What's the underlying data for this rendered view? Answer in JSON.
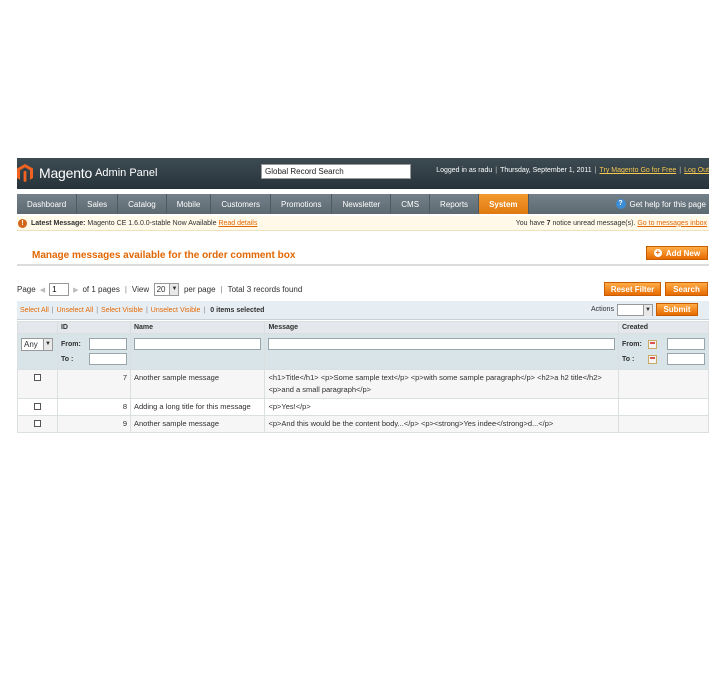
{
  "header": {
    "logo_text": "Magento",
    "logo_sub": "Admin Panel",
    "global_search_value": "Global Record Search",
    "logged_in": "Logged in as radu",
    "date": "Thursday, September 1, 2011",
    "try_link": "Try Magento Go for Free",
    "logout_link": "Log Out"
  },
  "nav": {
    "items": [
      "Dashboard",
      "Sales",
      "Catalog",
      "Mobile",
      "Customers",
      "Promotions",
      "Newsletter",
      "CMS",
      "Reports",
      "System"
    ],
    "active": "System",
    "help": "Get help for this page"
  },
  "notice": {
    "label": "Latest Message:",
    "text": "Magento CE 1.6.0.0-stable Now Available",
    "read_link": "Read details",
    "right_pre": "You have",
    "right_count": "7",
    "right_post": "notice unread message(s).",
    "inbox_link": "Go to messages inbox"
  },
  "page": {
    "title": "Manage messages available for the order comment box",
    "add_button": "Add New"
  },
  "pager": {
    "page_label": "Page",
    "page_value": "1",
    "of_pages": "of 1 pages",
    "view_label": "View",
    "per_page_value": "20",
    "per_page_label": "per page",
    "total": "Total 3 records found",
    "reset_button": "Reset Filter",
    "search_button": "Search"
  },
  "massaction": {
    "select_all": "Select All",
    "unselect_all": "Unselect All",
    "select_visible": "Select Visible",
    "unselect_visible": "Unselect Visible",
    "count": "0",
    "items_selected": "items selected",
    "actions_label": "Actions",
    "submit_button": "Submit"
  },
  "grid": {
    "columns": [
      "",
      "ID",
      "Name",
      "Message",
      "Created"
    ],
    "filter": {
      "any_value": "Any",
      "from_label": "From:",
      "to_label": "To :"
    },
    "rows": [
      {
        "id": "7",
        "name": "Another sample message",
        "message": "<h1>Title</h1> <p>Some sample text</p> <p>with some sample paragraph</p> <h2>a h2 title</h2> <p>and a small paragraph</p>"
      },
      {
        "id": "8",
        "name": "Adding a long title for this message",
        "message": "<p>Yes!</p>"
      },
      {
        "id": "9",
        "name": "Another sample message",
        "message": "<p>And this would be the content body...</p> <p><strong>Yes indee</strong>d...</p>"
      }
    ]
  },
  "colors": {
    "accent": "#e26703",
    "header_bg": "#2f3c43",
    "nav_bg": "#66737b",
    "active_tab": "#ec8a1f"
  }
}
